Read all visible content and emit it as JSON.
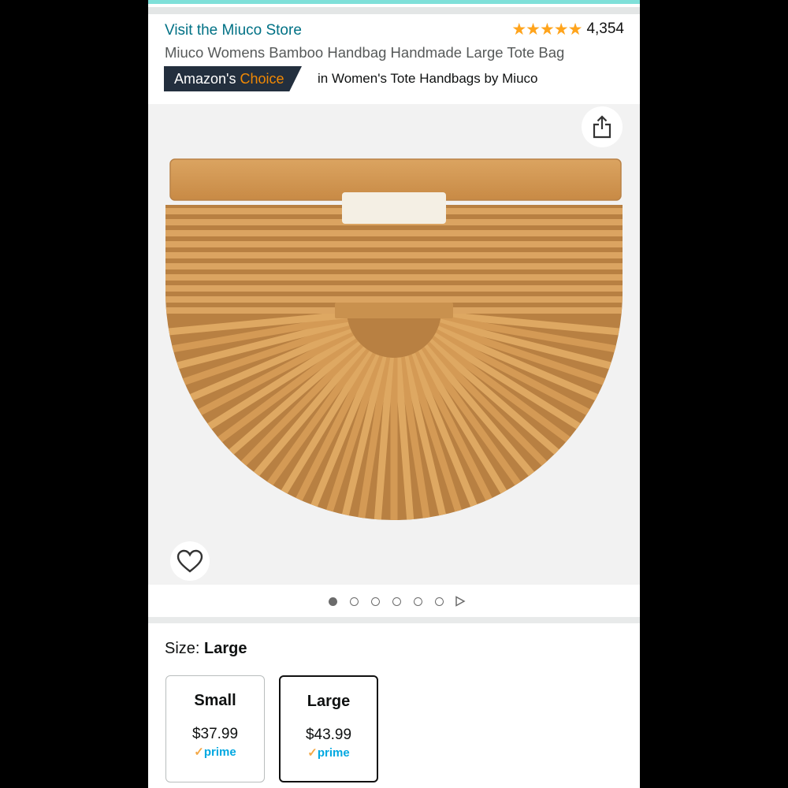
{
  "header": {
    "store_link": "Visit the Miuco Store",
    "rating_stars": 5,
    "rating_count": "4,354",
    "title": "Miuco Womens Bamboo Handbag Handmade Large Tote Bag",
    "choice_amazon": "Amazon's",
    "choice_word": "Choice",
    "choice_category": "in Women's Tote Handbags by Miuco"
  },
  "gallery": {
    "image_count": 6,
    "active_index": 0
  },
  "size": {
    "label": "Size:",
    "selected": "Large",
    "options": [
      {
        "name": "Small",
        "price": "$37.99",
        "prime_check": "✓",
        "prime": "prime"
      },
      {
        "name": "Large",
        "price": "$43.99",
        "prime_check": "✓",
        "prime": "prime"
      }
    ]
  },
  "colors": {
    "link": "#007185",
    "star": "#ffa41c",
    "badge_bg": "#232f3e",
    "badge_accent": "#f08804",
    "prime": "#00a8e1"
  }
}
